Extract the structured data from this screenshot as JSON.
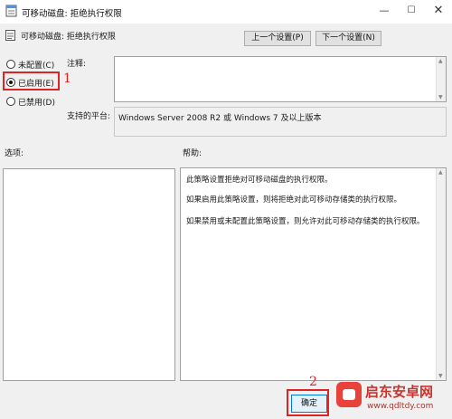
{
  "window": {
    "title": "可移动磁盘: 拒绝执行权限",
    "minimize_glyph": "—",
    "maximize_glyph": "☐",
    "close_glyph": "✕"
  },
  "header": {
    "policy_name": "可移动磁盘: 拒绝执行权限",
    "prev_button": "上一个设置(P)",
    "next_button": "下一个设置(N)"
  },
  "state_options": [
    {
      "label": "未配置(C)",
      "checked": false
    },
    {
      "label": "已启用(E)",
      "checked": true
    },
    {
      "label": "已禁用(D)",
      "checked": false
    }
  ],
  "comment": {
    "label": "注释:",
    "value": ""
  },
  "platform": {
    "label": "支持的平台:",
    "value": "Windows Server 2008 R2 或 Windows 7 及以上版本"
  },
  "options": {
    "label": "选项:"
  },
  "help": {
    "label": "帮助:",
    "lines": [
      "此策略设置拒绝对可移动磁盘的执行权限。",
      "如果启用此策略设置，则将拒绝对此可移动存储类的执行权限。",
      "如果禁用或未配置此策略设置，则允许对此可移动存储类的执行权限。"
    ]
  },
  "footer": {
    "ok_button": "确定"
  },
  "annotations": {
    "step1": "1",
    "step2": "2",
    "color": "#e02424"
  },
  "watermark": {
    "title": "启东安卓网",
    "url": "www.qdltdy.com"
  },
  "icons": {
    "title_icon": "policy-document-icon",
    "header_icon": "policy-setting-icon"
  }
}
